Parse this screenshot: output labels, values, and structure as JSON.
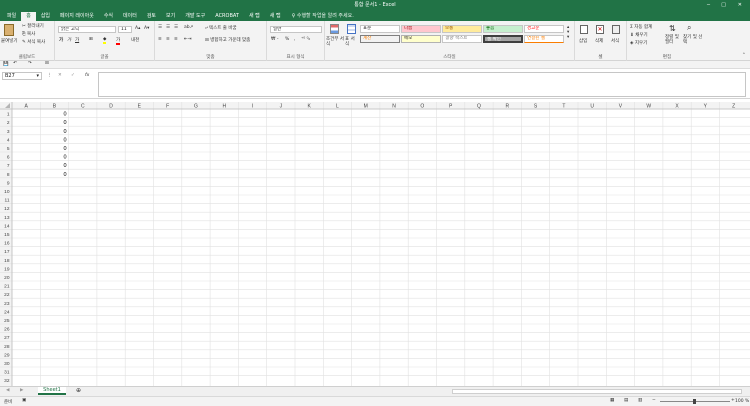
{
  "window": {
    "title": "통합 문서1 - Excel"
  },
  "tabs": [
    "파일",
    "홈",
    "삽입",
    "페이지 레이아웃",
    "수식",
    "데이터",
    "검토",
    "보기",
    "개발 도구",
    "ACROBAT",
    "새 탭",
    "새 탭"
  ],
  "tell_me": "수행할 작업을 알려 주세요.",
  "ribbon": {
    "clipboard": {
      "paste": "붙여넣기",
      "cut": "잘라내기",
      "copy": "복사",
      "format_painter": "서식 복사",
      "label": "클립보드"
    },
    "font": {
      "name": "맑은 고딕",
      "size": "11",
      "label": "글꼴"
    },
    "alignment": {
      "wrap": "텍스트 줄 바꿈",
      "merge": "병합하고 가운데 맞춤",
      "label": "맞춤"
    },
    "number": {
      "format": "일반",
      "label": "표시 형식"
    },
    "styles": {
      "conditional": "조건부 서식",
      "table": "표 서식",
      "cells": [
        {
          "text": "표준",
          "bg": "#ffffff",
          "color": "#000000"
        },
        {
          "text": "나쁨",
          "bg": "#ffc7ce",
          "color": "#9c0006"
        },
        {
          "text": "보통",
          "bg": "#ffeb9c",
          "color": "#9c5700"
        },
        {
          "text": "좋음",
          "bg": "#c6efce",
          "color": "#006100"
        },
        {
          "text": "경고문",
          "bg": "#ffffff",
          "color": "#ff0000"
        },
        {
          "text": "계산",
          "bg": "#f2f2f2",
          "color": "#fa7d00"
        },
        {
          "text": "메모",
          "bg": "#ffffcc",
          "color": "#000000"
        },
        {
          "text": "설명 텍스트",
          "bg": "#ffffff",
          "color": "#7f7f7f"
        },
        {
          "text": "셀 확인",
          "bg": "#a5a5a5",
          "color": "#ffffff"
        },
        {
          "text": "연결된 셀",
          "bg": "#ffffff",
          "color": "#fa7d00"
        }
      ],
      "label": "스타일"
    },
    "cells": {
      "insert": "삽입",
      "delete": "삭제",
      "format": "서식",
      "label": "셀"
    },
    "editing": {
      "autosum": "자동 합계",
      "fill": "채우기",
      "clear": "지우기",
      "sort": "정렬 및 필터",
      "find": "찾기 및 선택",
      "label": "편집"
    }
  },
  "formula_bar": {
    "name_box": "B27",
    "fx": "fx",
    "value": ""
  },
  "grid": {
    "columns": [
      "A",
      "B",
      "C",
      "D",
      "E",
      "F",
      "G",
      "H",
      "I",
      "J",
      "K",
      "L",
      "M",
      "N",
      "O",
      "P",
      "Q",
      "R",
      "S",
      "T",
      "U",
      "V",
      "W",
      "X",
      "Y",
      "Z"
    ],
    "row_count": 32,
    "cells": {
      "B1": "0",
      "B2": "0",
      "B3": "0",
      "B4": "0",
      "B5": "0",
      "B6": "0",
      "B7": "0",
      "B8": "0"
    }
  },
  "sheets": [
    "Sheet1"
  ],
  "status": {
    "ready": "준비",
    "zoom": "100 %"
  },
  "colors": {
    "accent": "#217346",
    "gridline": "#e1e1e1",
    "header_bg": "#f3f3f3"
  }
}
